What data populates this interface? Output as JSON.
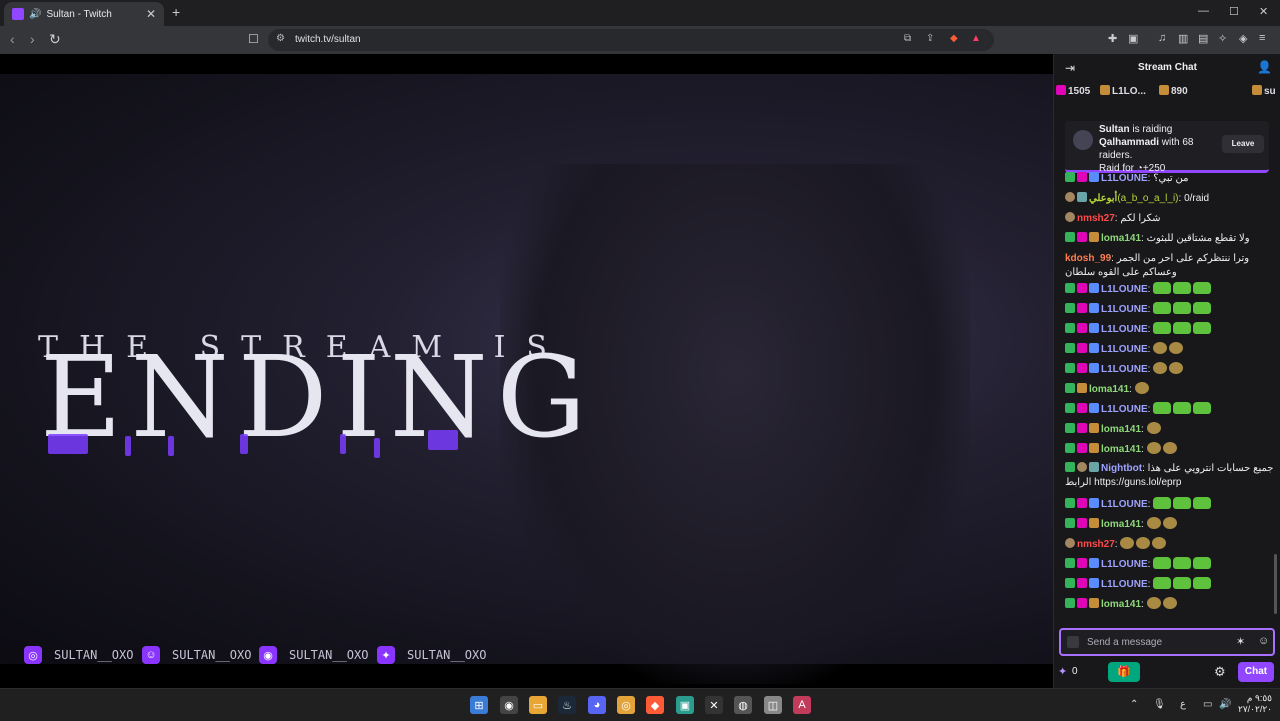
{
  "browser": {
    "tab_title": "Sultan - Twitch",
    "tab_close": "✕",
    "new_tab": "+",
    "url": "twitch.tv/sultan",
    "back": "‹",
    "forward": "›",
    "reload": "↻",
    "bookmark": "☐",
    "window_minimize": "—",
    "window_maximize": "☐",
    "window_close": "✕"
  },
  "stream": {
    "overlay_line1": "THE STREAM IS",
    "overlay_line2": "ENDING",
    "socials": [
      {
        "icon": "instagram-icon",
        "glyph": "◎",
        "handle": "SULTAN__OXO"
      },
      {
        "icon": "snapchat-icon",
        "glyph": "☺",
        "handle": "SULTAN__OXO"
      },
      {
        "icon": "discord-icon",
        "glyph": "◉",
        "handle": "SULTAN__OXO"
      },
      {
        "icon": "twitter-icon",
        "glyph": "✦",
        "handle": "SULTAN__OXO"
      }
    ]
  },
  "chat": {
    "title": "Stream Chat",
    "leaderboard": [
      {
        "value": "1505"
      },
      {
        "value": "L1LO..."
      },
      {
        "value": "890"
      },
      {
        "value": "su"
      }
    ],
    "raid": {
      "streamer": "Sultan",
      "text1": " is raiding",
      "target": "Qalhammadi",
      "text2": " with 68 raiders.",
      "raid_for": "Raid for ",
      "points": "+250",
      "leave": "Leave"
    },
    "messages": [
      {
        "name": "L1LOUNE",
        "color": "#9ea3ff",
        "badges": [
          "sub",
          "vip",
          "ver"
        ],
        "text": "من تبي؟",
        "emotes": []
      },
      {
        "name": "أبوعلي",
        "extra": "(a_b_o_a_l_i)",
        "color": "#b5d43a",
        "badges": [
          "skull",
          "bot"
        ],
        "text": "0/raid",
        "emotes": []
      },
      {
        "name": "nmsh27",
        "color": "#ff4a4a",
        "badges": [
          "skull"
        ],
        "text": "شكرا لكم",
        "emotes": []
      },
      {
        "name": "loma141",
        "color": "#8ed97a",
        "badges": [
          "sub",
          "vip",
          "gift"
        ],
        "text": "ولا تقطع مشتاقين للبثوث",
        "emotes": []
      },
      {
        "name": "kdosh_99",
        "color": "#ff7f50",
        "badges": [],
        "text": "وترا ننتظركم على احر من الجمر وعساكم على القوه سلطان",
        "emotes": []
      },
      {
        "name": "L1LOUNE",
        "color": "#9ea3ff",
        "badges": [
          "sub",
          "vip",
          "ver"
        ],
        "text": "",
        "emotes": [
          "cat",
          "cat",
          "cat"
        ]
      },
      {
        "name": "L1LOUNE",
        "color": "#9ea3ff",
        "badges": [
          "sub",
          "vip",
          "ver"
        ],
        "text": "",
        "emotes": [
          "cat",
          "cat",
          "cat"
        ]
      },
      {
        "name": "L1LOUNE",
        "color": "#9ea3ff",
        "badges": [
          "sub",
          "vip",
          "ver"
        ],
        "text": "",
        "emotes": [
          "cat",
          "cat",
          "cat"
        ]
      },
      {
        "name": "L1LOUNE",
        "color": "#9ea3ff",
        "badges": [
          "sub",
          "vip",
          "ver"
        ],
        "text": "",
        "emotes": [
          "gold",
          "gold"
        ]
      },
      {
        "name": "L1LOUNE",
        "color": "#9ea3ff",
        "badges": [
          "sub",
          "vip",
          "ver"
        ],
        "text": "",
        "emotes": [
          "gold",
          "gold"
        ]
      },
      {
        "name": "loma141",
        "color": "#8ed97a",
        "badges": [
          "sub",
          "gift"
        ],
        "text": "",
        "emotes": [
          "gold"
        ]
      },
      {
        "name": "L1LOUNE",
        "color": "#9ea3ff",
        "badges": [
          "sub",
          "vip",
          "ver"
        ],
        "text": "",
        "emotes": [
          "cat",
          "cat",
          "cat"
        ]
      },
      {
        "name": "loma141",
        "color": "#8ed97a",
        "badges": [
          "sub",
          "vip",
          "gift"
        ],
        "text": "",
        "emotes": [
          "gold"
        ]
      },
      {
        "name": "loma141",
        "color": "#8ed97a",
        "badges": [
          "sub",
          "vip",
          "gift"
        ],
        "text": "",
        "emotes": [
          "gold",
          "gold"
        ]
      },
      {
        "name": "Nightbot",
        "color": "#9ea3ff",
        "badges": [
          "sub",
          "skull",
          "bot"
        ],
        "text": "جميع حسابات انترويي على هذا الرابط https://guns.lol/eprp",
        "emotes": []
      },
      {
        "name": "L1LOUNE",
        "color": "#9ea3ff",
        "badges": [
          "sub",
          "vip",
          "ver"
        ],
        "text": "",
        "emotes": [
          "cat",
          "cat",
          "cat"
        ]
      },
      {
        "name": "loma141",
        "color": "#8ed97a",
        "badges": [
          "sub",
          "vip",
          "gift"
        ],
        "text": "",
        "emotes": [
          "gold",
          "gold"
        ]
      },
      {
        "name": "nmsh27",
        "color": "#ff4a4a",
        "badges": [
          "skull"
        ],
        "text": "",
        "emotes": [
          "gold",
          "gold",
          "gold"
        ]
      },
      {
        "name": "L1LOUNE",
        "color": "#9ea3ff",
        "badges": [
          "sub",
          "vip",
          "ver"
        ],
        "text": "",
        "emotes": [
          "cat",
          "cat",
          "cat"
        ]
      },
      {
        "name": "L1LOUNE",
        "color": "#9ea3ff",
        "badges": [
          "sub",
          "vip",
          "ver"
        ],
        "text": "",
        "emotes": [
          "cat",
          "cat",
          "cat"
        ]
      },
      {
        "name": "loma141",
        "color": "#8ed97a",
        "badges": [
          "sub",
          "vip",
          "gift"
        ],
        "text": "",
        "emotes": [
          "gold",
          "gold"
        ]
      }
    ],
    "input_placeholder": "Send a message",
    "points": "0",
    "chat_button": "Chat"
  },
  "taskbar": {
    "ime": "ع",
    "time": "٩:٥٥ م",
    "date": "٢٧/٠٢/٢٠"
  },
  "colors": {
    "accent": "#9147ff",
    "overlay_purple": "#8a35ff"
  }
}
